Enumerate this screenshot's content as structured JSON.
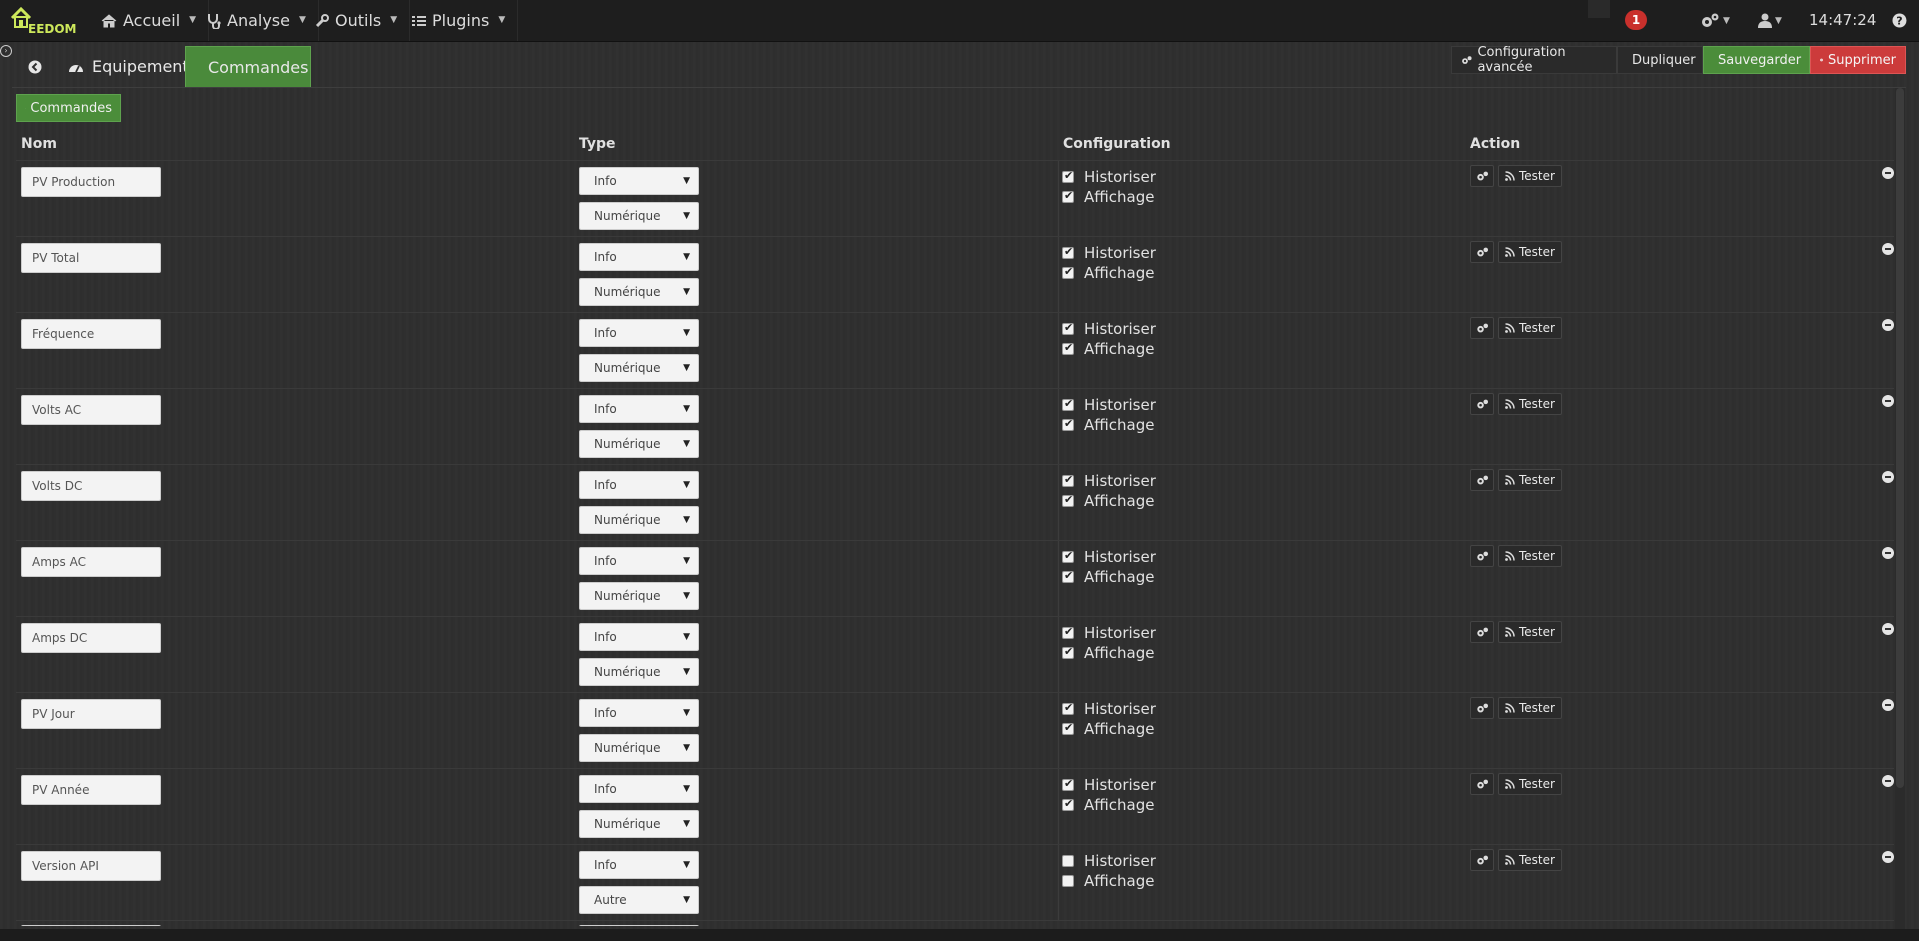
{
  "navbar": {
    "logo_text": "EEDOM",
    "menus": [
      {
        "label": "Accueil",
        "icon": "home-icon"
      },
      {
        "label": "Analyse",
        "icon": "stethoscope-icon"
      },
      {
        "label": "Outils",
        "icon": "wrench-icon"
      },
      {
        "label": "Plugins",
        "icon": "tasks-icon"
      }
    ],
    "notification_count": "1",
    "time": "14:47:24"
  },
  "tabs": {
    "equipement": "Equipement",
    "commandes": "Commandes"
  },
  "toolbar": {
    "config_avancee": "Configuration avancée",
    "dupliquer": "Dupliquer",
    "sauvegarder": "Sauvegarder",
    "supprimer": "Supprimer"
  },
  "add_command_label": "Commandes",
  "table": {
    "headers": {
      "nom": "Nom",
      "type": "Type",
      "configuration": "Configuration",
      "action": "Action"
    },
    "historiser_label": "Historiser",
    "affichage_label": "Affichage",
    "tester_label": "Tester",
    "rows": [
      {
        "name": "PV Production",
        "type": "Info",
        "subtype": "Numérique",
        "historiser": true,
        "affichage": true
      },
      {
        "name": "PV Total",
        "type": "Info",
        "subtype": "Numérique",
        "historiser": true,
        "affichage": true
      },
      {
        "name": "Fréquence",
        "type": "Info",
        "subtype": "Numérique",
        "historiser": true,
        "affichage": true
      },
      {
        "name": "Volts AC",
        "type": "Info",
        "subtype": "Numérique",
        "historiser": true,
        "affichage": true
      },
      {
        "name": "Volts DC",
        "type": "Info",
        "subtype": "Numérique",
        "historiser": true,
        "affichage": true
      },
      {
        "name": "Amps AC",
        "type": "Info",
        "subtype": "Numérique",
        "historiser": true,
        "affichage": true
      },
      {
        "name": "Amps DC",
        "type": "Info",
        "subtype": "Numérique",
        "historiser": true,
        "affichage": true
      },
      {
        "name": "PV Jour",
        "type": "Info",
        "subtype": "Numérique",
        "historiser": true,
        "affichage": true
      },
      {
        "name": "PV Année",
        "type": "Info",
        "subtype": "Numérique",
        "historiser": true,
        "affichage": true
      },
      {
        "name": "Version API",
        "type": "Info",
        "subtype": "Autre",
        "historiser": false,
        "affichage": false
      }
    ]
  },
  "colors": {
    "success": "#4b8d3a",
    "danger": "#cc3b3b",
    "badge": "#c9302c",
    "logo": "#cde85b"
  }
}
